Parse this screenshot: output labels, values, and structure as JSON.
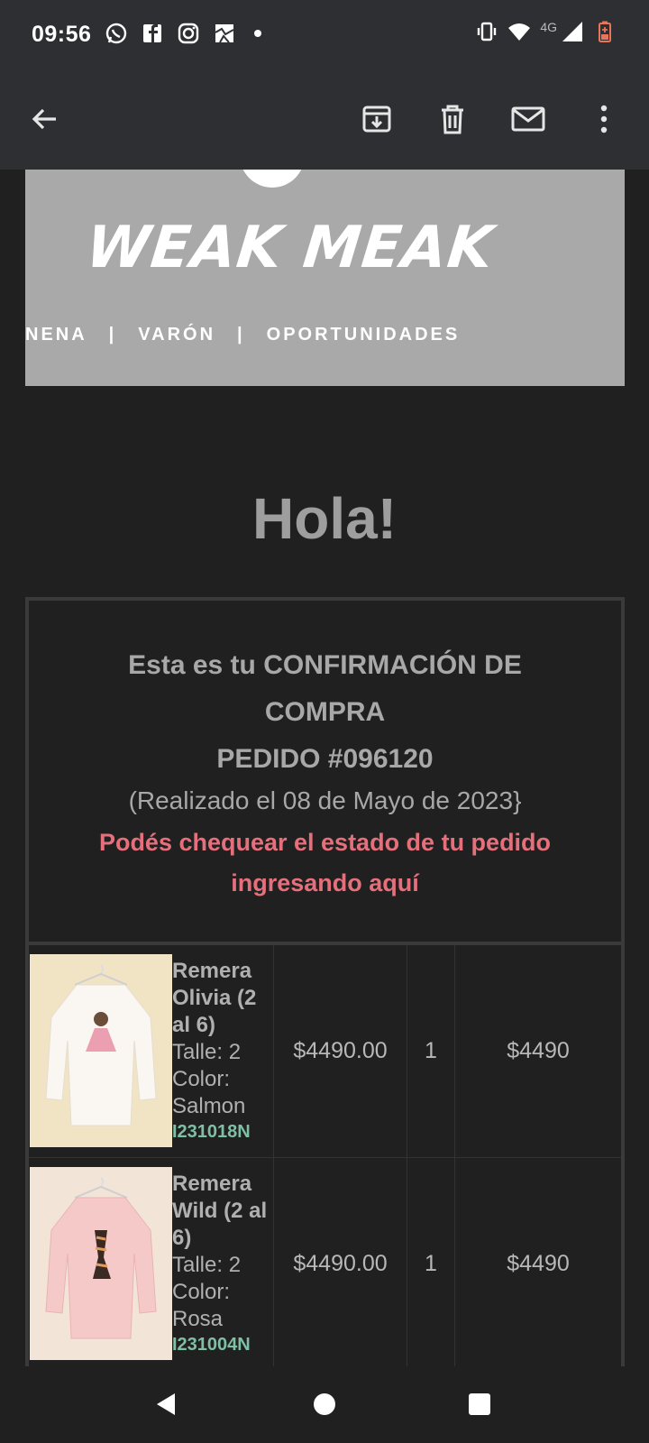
{
  "status_bar": {
    "time": "09:56",
    "network_label": "4G",
    "notification_icons": [
      "whatsapp-icon",
      "facebook-icon",
      "instagram-icon",
      "gallery-icon"
    ],
    "system_icons": [
      "vibrate-icon",
      "wifi-icon",
      "signal-icon",
      "battery-low-icon"
    ]
  },
  "app_bar": {
    "back_icon": "arrow-back-icon",
    "actions": [
      "archive-icon",
      "delete-icon",
      "mark-unread-icon",
      "more-icon"
    ]
  },
  "email": {
    "brand_logo": "WEAK MEAK",
    "banner_nav": [
      "NENA",
      "|",
      "VARÓN",
      "|",
      "OPORTUNIDADES"
    ],
    "greeting": "Hola!",
    "confirmation_line": "Esta es tu CONFIRMACIÓN DE COMPRA",
    "order_number": "PEDIDO #096120",
    "order_date": "(Realizado el 08 de Mayo de 2023}",
    "status_link": "Podés chequear el estado de tu pedido ingresando aquí",
    "products": [
      {
        "name": "Remera Olivia (2 al 6)",
        "size": "Talle: 2",
        "color": "Color: Salmon",
        "sku": "I231018N",
        "unit_price": "$4490.00",
        "quantity": "1",
        "total": "$4490"
      },
      {
        "name": "Remera Wild (2 al 6)",
        "size": "Talle: 2",
        "color": "Color: Rosa",
        "sku": "I231004N",
        "unit_price": "$4490.00",
        "quantity": "1",
        "total": "$4490"
      }
    ]
  },
  "nav_bar": [
    "back-triangle-icon",
    "home-circle-icon",
    "recents-square-icon"
  ]
}
